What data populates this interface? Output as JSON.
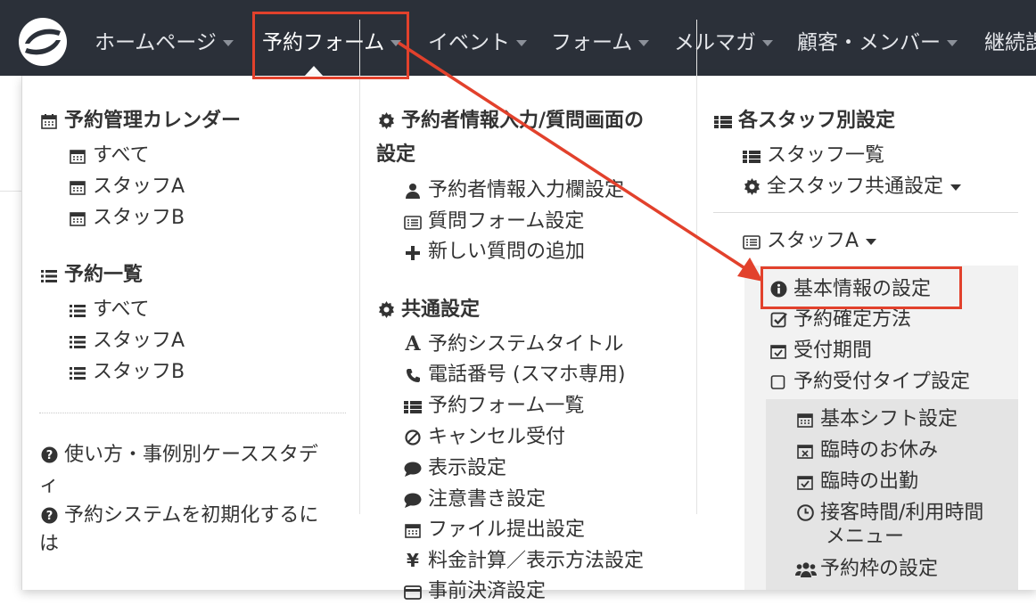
{
  "nav": {
    "items": [
      {
        "label": "ホームページ",
        "has_caret": true
      },
      {
        "label": "予約フォーム",
        "has_caret": true,
        "active": true
      },
      {
        "label": "イベント",
        "has_caret": true
      },
      {
        "label": "フォーム",
        "has_caret": true
      },
      {
        "label": "メルマガ",
        "has_caret": true
      },
      {
        "label": "顧客・メンバー",
        "has_caret": true
      },
      {
        "label": "継続課",
        "has_caret": false
      }
    ]
  },
  "col1": {
    "calendar_header": "予約管理カレンダー",
    "calendar_items": [
      "すべて",
      "スタッフA",
      "スタッフB"
    ],
    "list_header": "予約一覧",
    "list_items": [
      "すべて",
      "スタッフA",
      "スタッフB"
    ],
    "help1_line1": "使い方・事例別ケーススタデ",
    "help1_line2": "ィ",
    "help2_line1": "予約システムを初期化するに",
    "help2_line2": "は"
  },
  "col2": {
    "booker_header_line1": "予約者情報入力/質問画面の",
    "booker_header_line2": "設定",
    "booker_items": [
      "予約者情報入力欄設定",
      "質問フォーム設定",
      "新しい質問の追加"
    ],
    "common_header": "共通設定",
    "common_items": [
      {
        "icon": "font-icon",
        "label": "予約システムタイトル"
      },
      {
        "icon": "phone-icon",
        "label": "電話番号 (スマホ専用)"
      },
      {
        "icon": "list-icon",
        "label": "予約フォーム一覧"
      },
      {
        "icon": "ban-icon",
        "label": "キャンセル受付"
      },
      {
        "icon": "comment-icon",
        "label": "表示設定"
      },
      {
        "icon": "comment-icon",
        "label": "注意書き設定"
      },
      {
        "icon": "calendar-icon",
        "label": "ファイル提出設定"
      },
      {
        "icon": "yen-icon",
        "label": "料金計算／表示方法設定"
      },
      {
        "icon": "card-icon",
        "label": "事前決済設定"
      }
    ]
  },
  "col3": {
    "staff_header": "各スタッフ別設定",
    "staff_list": "スタッフ一覧",
    "all_staff_common": "全スタッフ共通設定",
    "staff_a": "スタッフA",
    "staff_a_items": [
      {
        "icon": "info-icon",
        "label": "基本情報の設定"
      },
      {
        "icon": "check-square-icon",
        "label": "予約確定方法"
      },
      {
        "icon": "calendar-check-icon",
        "label": "受付期間"
      },
      {
        "icon": "square-icon",
        "label": "予約受付タイプ設定"
      }
    ],
    "sub_items": [
      {
        "icon": "calendar-icon",
        "label": "基本シフト設定"
      },
      {
        "icon": "calendar-times-icon",
        "label": "臨時のお休み"
      },
      {
        "icon": "calendar-check-icon",
        "label": "臨時の出勤"
      },
      {
        "icon": "clock-icon",
        "label": "接客時間/利用時間"
      },
      {
        "icon": "",
        "label": "メニュー"
      },
      {
        "icon": "users-icon",
        "label": "予約枠の設定"
      }
    ]
  },
  "colors": {
    "navbar": "#2b3039",
    "annotation": "#e2412c"
  }
}
